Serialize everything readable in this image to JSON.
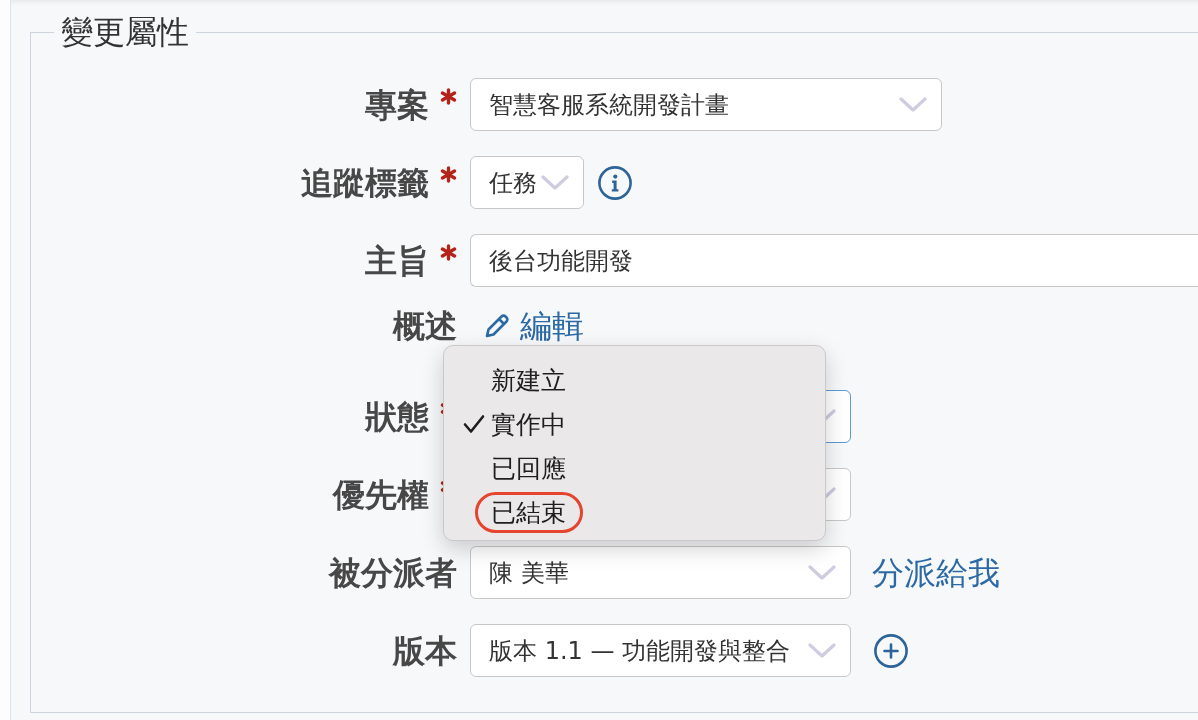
{
  "fieldset": {
    "legend": "變更屬性"
  },
  "fields": [
    {
      "kind": "select",
      "label": "專案",
      "required": true,
      "value": "智慧客服系統開發計畫",
      "focused": false
    },
    {
      "kind": "select",
      "label": "追蹤標籤",
      "required": true,
      "value": "任務",
      "focused": false,
      "action": {
        "kind": "help"
      }
    },
    {
      "kind": "text",
      "label": "主旨",
      "required": true,
      "value": "後台功能開發",
      "focused": false
    },
    {
      "kind": "edit",
      "label": "概述",
      "required": false,
      "link": "編輯"
    },
    {
      "kind": "select",
      "label": "狀態",
      "required": true,
      "focused": true,
      "menu": {
        "options": [
          {
            "label": "新建立",
            "selected": false,
            "circled": false
          },
          {
            "label": "實作中",
            "selected": true,
            "circled": false
          },
          {
            "label": "已回應",
            "selected": false,
            "circled": false
          },
          {
            "label": "已結束",
            "selected": false,
            "circled": true
          }
        ]
      }
    },
    {
      "kind": "select",
      "label": "優先權",
      "required": true,
      "focused": false
    },
    {
      "kind": "select",
      "label": "被分派者",
      "required": false,
      "value": "陳 美華",
      "focused": false,
      "action": {
        "kind": "link",
        "label": "分派給我"
      }
    },
    {
      "kind": "select",
      "label": "版本",
      "required": false,
      "value": "版本 1.1 — 功能開發與整合",
      "focused": false,
      "action": {
        "kind": "add"
      }
    }
  ]
}
